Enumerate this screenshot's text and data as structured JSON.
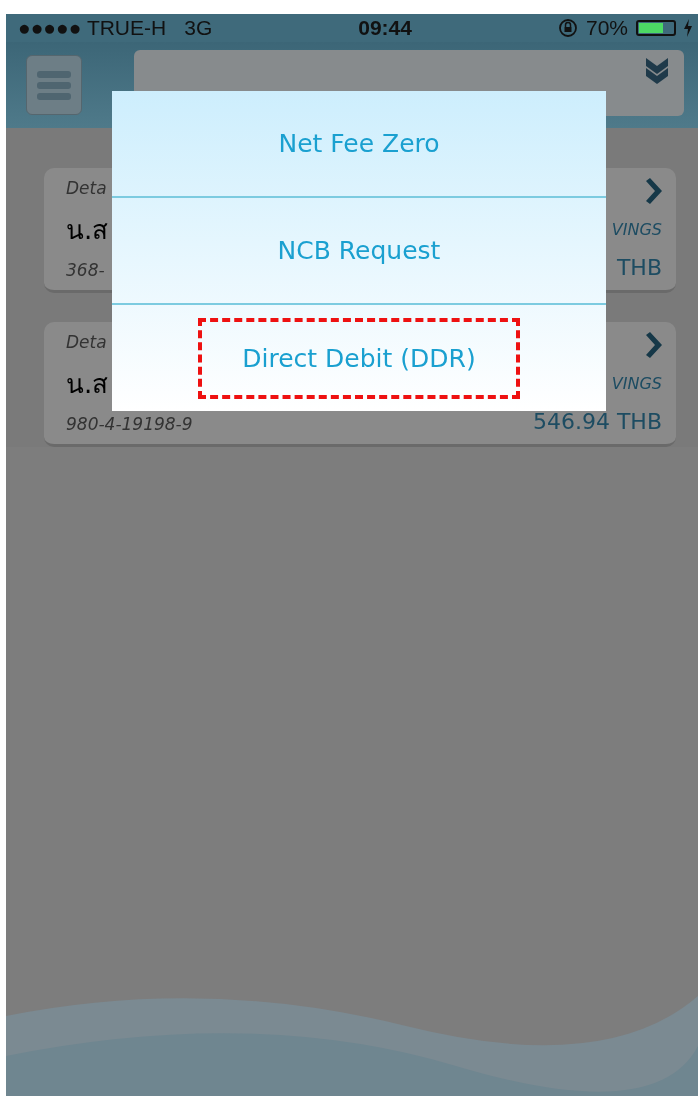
{
  "status_bar": {
    "carrier": "●●●●● TRUE-H",
    "network": "3G",
    "time": "09:44",
    "battery_percent": "70%",
    "charging": true
  },
  "accounts": [
    {
      "label": "Deta",
      "name": "น.ส",
      "number": "368-",
      "type": "VINGS",
      "balance": "THB"
    },
    {
      "label": "Deta",
      "name": "น.ส",
      "number": "980-4-19198-9",
      "type": "VINGS",
      "balance": "546.94 THB"
    }
  ],
  "menu": [
    {
      "label": "Net Fee Zero",
      "annotated": false
    },
    {
      "label": "NCB Request",
      "annotated": false
    },
    {
      "label": "Direct Debit (DDR)",
      "annotated": true
    }
  ]
}
